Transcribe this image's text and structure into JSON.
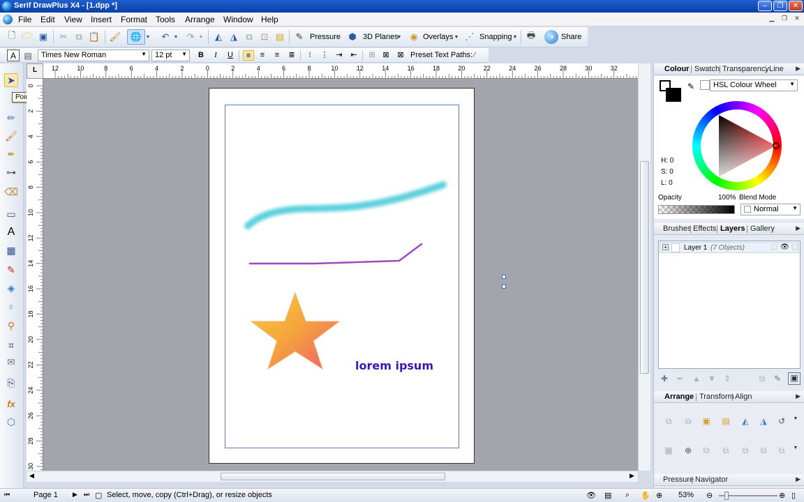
{
  "window": {
    "title": "Serif DrawPlus X4 - [1.dpp *]"
  },
  "menu": [
    "File",
    "Edit",
    "View",
    "Insert",
    "Format",
    "Tools",
    "Arrange",
    "Window",
    "Help"
  ],
  "toolbar1": {
    "pressure": "Pressure",
    "planes": "3D Planes",
    "overlays": "Overlays",
    "snapping": "Snapping",
    "share": "Share"
  },
  "toolbar2": {
    "font": "Times New Roman",
    "size": "12 pt",
    "bold": "B",
    "italic": "I",
    "underline": "U",
    "preset_paths": "Preset Text Paths:"
  },
  "tooltip": "Pointer Tool",
  "ruler": {
    "corner": "L",
    "h_ticks": [
      "12",
      "10",
      "8",
      "6",
      "4",
      "2",
      "0",
      "2",
      "4",
      "6",
      "8",
      "10",
      "12",
      "14",
      "16",
      "18",
      "20",
      "22",
      "24",
      "26",
      "28",
      "30",
      "32"
    ],
    "v_ticks": [
      "0",
      "2",
      "4",
      "6",
      "8",
      "10",
      "12",
      "14",
      "16",
      "18",
      "20",
      "22",
      "24",
      "26",
      "28",
      "30"
    ]
  },
  "page": {
    "text": "lorem ipsum"
  },
  "colors": {
    "pink_stroke": "#d94d97",
    "cyan_stroke": "#5fd0dd",
    "purple_line": "#9a4bbf",
    "text_blue": "#3a16b8"
  },
  "colour_panel": {
    "tabs": [
      "Colour",
      "Swatch",
      "Transparency",
      "Line"
    ],
    "mode": "HSL Colour Wheel",
    "h": "H: 0",
    "s": "S: 0",
    "l": "L: 0",
    "opacity_label": "Opacity",
    "opacity_value": "100%",
    "blend_label": "Blend Mode",
    "blend_value": "Normal"
  },
  "layers_panel": {
    "tabs": [
      "Brushes",
      "Effects",
      "Layers",
      "Gallery"
    ],
    "layer_name": "Layer 1",
    "layer_count": "(7 Objects)"
  },
  "arrange_panel": {
    "tabs": [
      "Arrange",
      "Transform",
      "Align"
    ]
  },
  "pressure_panel": {
    "tabs": [
      "Pressure",
      "Navigator"
    ]
  },
  "status": {
    "page": "Page 1",
    "message": "Select, move, copy (Ctrl+Drag), or resize objects",
    "zoom": "53%"
  }
}
